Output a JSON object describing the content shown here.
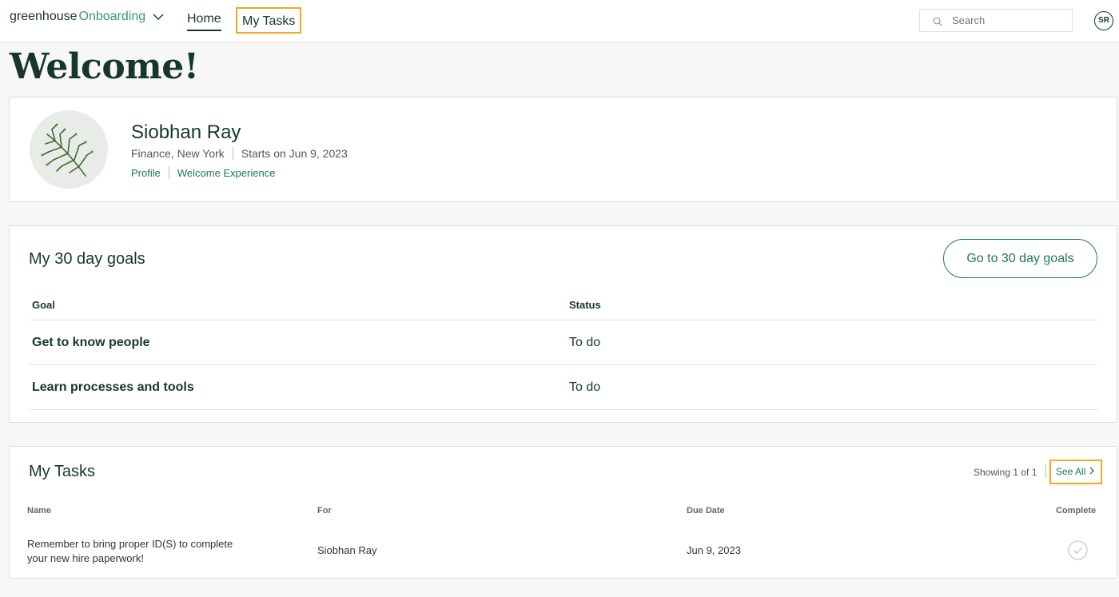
{
  "nav": {
    "brand_primary": "greenhouse",
    "brand_secondary": "Onboarding",
    "home_label": "Home",
    "my_tasks_label": "My Tasks",
    "search_placeholder": "Search",
    "user_initials": "SR"
  },
  "page_title": "Welcome!",
  "profile": {
    "name": "Siobhan Ray",
    "location": "Finance, New York",
    "start_text": "Starts on Jun 9, 2023",
    "profile_link": "Profile",
    "welcome_link": "Welcome Experience"
  },
  "goals": {
    "title": "My 30 day goals",
    "button_label": "Go to 30 day goals",
    "columns": [
      "Goal",
      "Status"
    ],
    "rows": [
      {
        "goal": "Get to know people",
        "status": "To do"
      },
      {
        "goal": "Learn processes and tools",
        "status": "To do"
      }
    ]
  },
  "tasks": {
    "title": "My Tasks",
    "showing": "Showing 1 of 1",
    "see_all": "See All",
    "columns": [
      "Name",
      "For",
      "Due Date",
      "Complete"
    ],
    "rows": [
      {
        "name_line1": "Remember to bring proper ID(S) to complete",
        "name_line2": "your new hire paperwork!",
        "for": "Siobhan Ray",
        "due": "Jun 9, 2023",
        "complete": false
      }
    ]
  },
  "colors": {
    "brand_green": "#1e7a52",
    "dark_green": "#15372c",
    "highlight_orange": "#f5a623"
  }
}
